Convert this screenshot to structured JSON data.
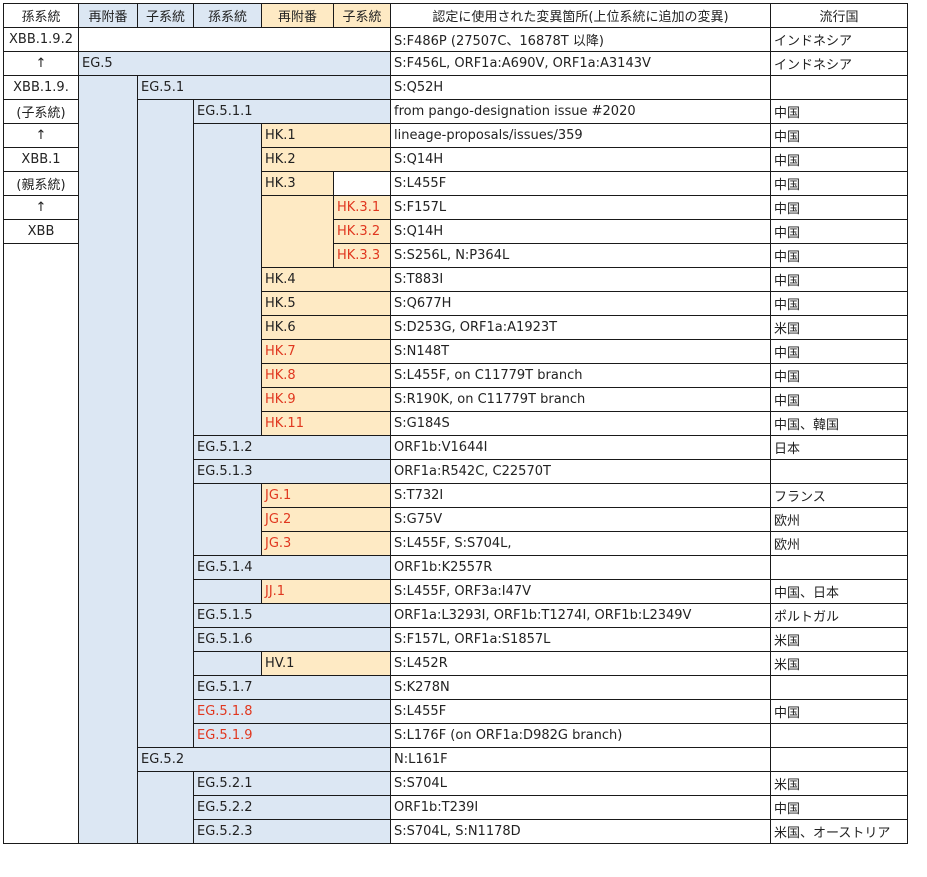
{
  "header": [
    "孫系統",
    "再附番",
    "子系統",
    "孫系統",
    "再附番",
    "子系統",
    "認定に使用された変異箇所(上位系統に追加の変異)",
    "流行国"
  ],
  "lineage_path": [
    "XBB.1.9.2",
    "↑",
    "XBB.1.9.",
    "(子系統)",
    "↑",
    "XBB.1",
    "(親系統)",
    "↑",
    "XBB"
  ],
  "rows": [
    {
      "name": "",
      "mutations": "S:F486P (27507C、16878T 以降)",
      "countries": "インドネシア"
    },
    {
      "name": "EG.5",
      "mutations": " S:F456L, ORF1a:A690V, ORF1a:A3143V",
      "countries": "インドネシア"
    },
    {
      "name": "EG.5.1",
      "mutations": "S:Q52H",
      "countries": ""
    },
    {
      "name": "EG.5.1.1",
      "mutations": "from pango-designation issue #2020",
      "countries": "中国"
    },
    {
      "name": "HK.1",
      "mutations": "lineage-proposals/issues/359",
      "countries": "中国"
    },
    {
      "name": "HK.2",
      "mutations": "S:Q14H",
      "countries": "中国"
    },
    {
      "name": "HK.3",
      "mutations": "S:L455F",
      "countries": "中国"
    },
    {
      "name": "HK.3.1",
      "mutations": "S:F157L",
      "countries": "中国"
    },
    {
      "name": "HK.3.2",
      "mutations": "S:Q14H",
      "countries": "中国"
    },
    {
      "name": "HK.3.3",
      "mutations": " S:S256L, N:P364L",
      "countries": "中国"
    },
    {
      "name": "HK.4",
      "mutations": "S:T883I",
      "countries": "中国"
    },
    {
      "name": "HK.5",
      "mutations": "S:Q677H",
      "countries": "中国"
    },
    {
      "name": "HK.6",
      "mutations": " S:D253G, ORF1a:A1923T",
      "countries": "米国"
    },
    {
      "name": "HK.7",
      "mutations": "S:N148T",
      "countries": "中国"
    },
    {
      "name": "HK.8",
      "mutations": "S:L455F, on C11779T branch",
      "countries": "中国"
    },
    {
      "name": "HK.9",
      "mutations": "S:R190K, on C11779T branch",
      "countries": "中国"
    },
    {
      "name": "HK.11",
      "mutations": "S:G184S",
      "countries": "中国、韓国"
    },
    {
      "name": "EG.5.1.2",
      "mutations": "ORF1b:V1644I",
      "countries": "日本"
    },
    {
      "name": "EG.5.1.3",
      "mutations": " ORF1a:R542C, C22570T",
      "countries": ""
    },
    {
      "name": "JG.1",
      "mutations": "S:T732I",
      "countries": "フランス"
    },
    {
      "name": "JG.2",
      "mutations": "S:G75V",
      "countries": "欧州"
    },
    {
      "name": "JG.3",
      "mutations": "S:L455F, S:S704L,",
      "countries": "欧州"
    },
    {
      "name": "EG.5.1.4",
      "mutations": "ORF1b:K2557R",
      "countries": ""
    },
    {
      "name": "JJ.1",
      "mutations": "S:L455F, ORF3a:I47V",
      "countries": "中国、日本"
    },
    {
      "name": "EG.5.1.5",
      "mutations": "ORF1a:L3293I, ORF1b:T1274I, ORF1b:L2349V",
      "countries": "ポルトガル"
    },
    {
      "name": "EG.5.1.6",
      "mutations": "S:F157L, ORF1a:S1857L",
      "countries": "米国"
    },
    {
      "name": "HV.1",
      "mutations": "S:L452R",
      "countries": "米国"
    },
    {
      "name": "EG.5.1.7",
      "mutations": "S:K278N",
      "countries": ""
    },
    {
      "name": "EG.5.1.8",
      "mutations": " S:L455F",
      "countries": "中国"
    },
    {
      "name": "EG.5.1.9",
      "mutations": "S:L176F (on ORF1a:D982G branch)",
      "countries": ""
    },
    {
      "name": "EG.5.2",
      "mutations": "N:L161F",
      "countries": ""
    },
    {
      "name": "EG.5.2.1",
      "mutations": "S:S704L",
      "countries": "米国"
    },
    {
      "name": "EG.5.2.2",
      "mutations": "ORF1b:T239I",
      "countries": "中国"
    },
    {
      "name": "EG.5.2.3",
      "mutations": "S:S704L, S:N1178D",
      "countries": "米国、オーストリア"
    }
  ],
  "colors": {
    "blue_fill": "#dce7f3",
    "amber_fill": "#feeac4",
    "red_text": "#e0371f",
    "border": "#1a1a1a"
  }
}
